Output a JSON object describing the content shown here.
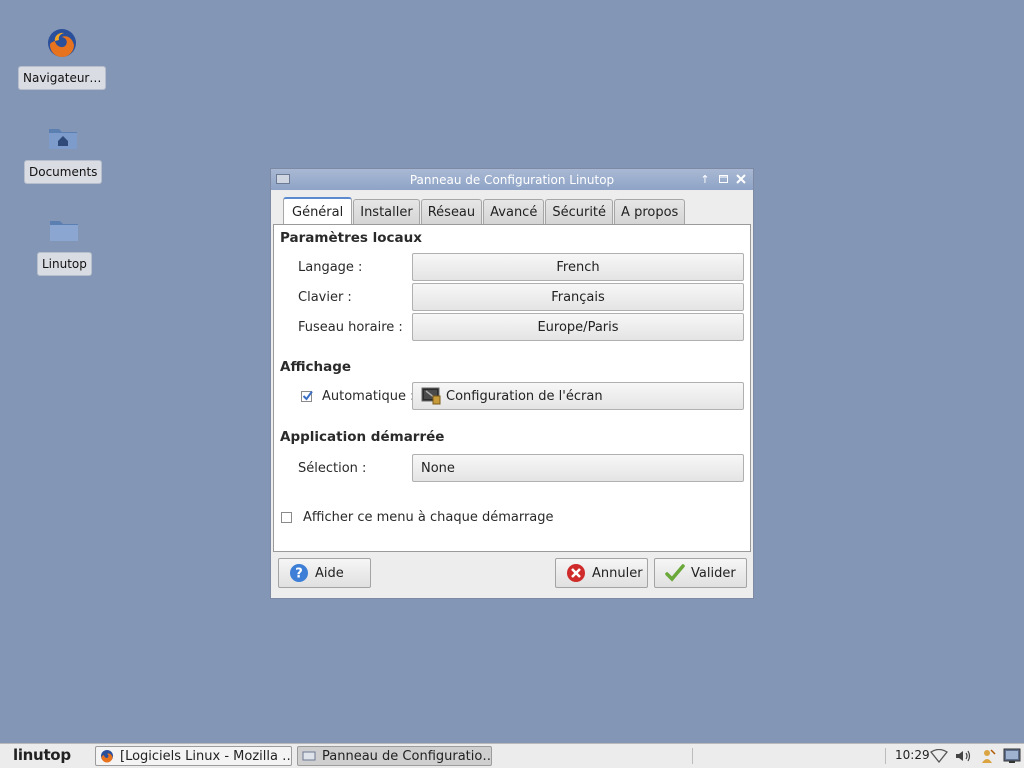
{
  "desktop": {
    "icons": [
      {
        "label": "Navigateur…",
        "icon": "firefox-icon"
      },
      {
        "label": "Documents",
        "icon": "home-folder-icon"
      },
      {
        "label": "Linutop",
        "icon": "folder-icon"
      }
    ]
  },
  "dialog": {
    "title": "Panneau de Configuration Linutop",
    "tabs": [
      "Général",
      "Installer",
      "Réseau",
      "Avancé",
      "Sécurité",
      "A propos"
    ],
    "active_tab": "Général",
    "sections": {
      "locale": {
        "title": "Paramètres locaux",
        "rows": [
          {
            "label": "Langage :",
            "value": "French"
          },
          {
            "label": "Clavier :",
            "value": "Français"
          },
          {
            "label": "Fuseau horaire :",
            "value": "Europe/Paris"
          }
        ]
      },
      "display": {
        "title": "Affichage",
        "auto_label": "Automatique :",
        "auto_checked": true,
        "screen_config_label": "Configuration de l'écran"
      },
      "startup": {
        "title": "Application démarrée",
        "selection_label": "Sélection :",
        "selection_value": "None"
      }
    },
    "show_menu_label": "Afficher ce menu à chaque démarrage",
    "show_menu_checked": false,
    "buttons": {
      "help": "Aide",
      "cancel": "Annuler",
      "ok": "Valider"
    }
  },
  "taskbar": {
    "logo": "linutop",
    "tasks": [
      {
        "label": "[Logiciels Linux - Mozilla …",
        "active": false
      },
      {
        "label": "Panneau de Configuratio…",
        "active": true
      }
    ],
    "clock": "10:29",
    "tray_icons": [
      "wifi-icon",
      "volume-icon",
      "user-icon",
      "screen-icon"
    ]
  },
  "colors": {
    "desktop": "#8496b5",
    "titlebar": "#9aacca",
    "tab_accent": "#5c8ad1"
  }
}
